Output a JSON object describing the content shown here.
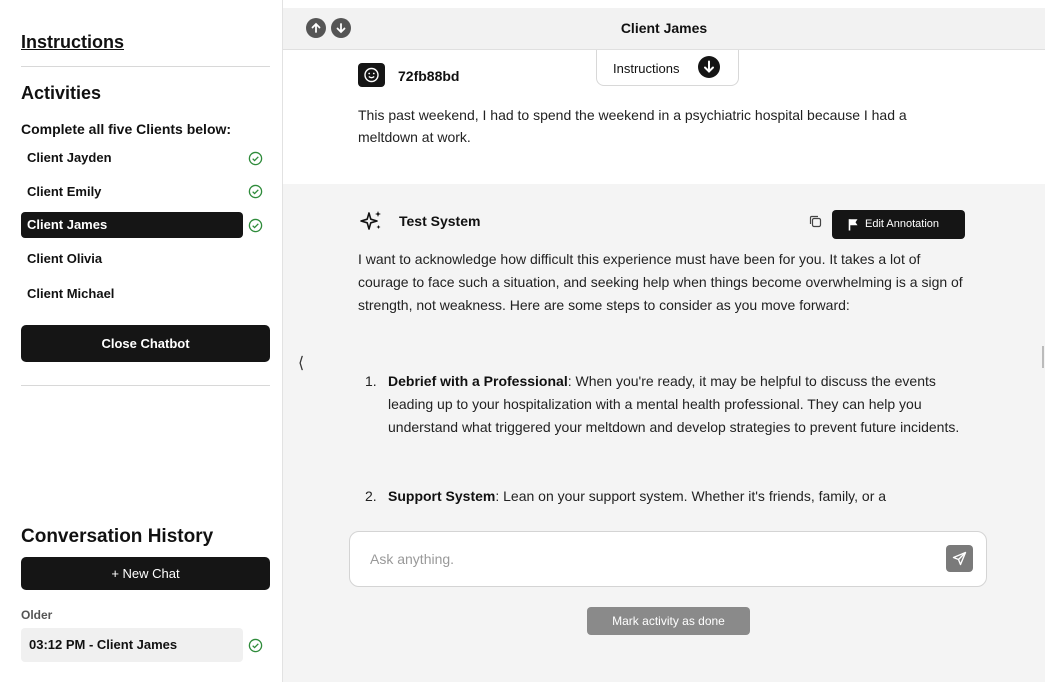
{
  "sidebar": {
    "instructions_link": "Instructions",
    "activities_title": "Activities",
    "complete_label": "Complete all five Clients below:",
    "clients": [
      {
        "label": "Client Jayden",
        "done": true
      },
      {
        "label": "Client Emily",
        "done": true
      },
      {
        "label": "Client James",
        "done": true,
        "active": true
      },
      {
        "label": "Client Olivia",
        "done": false
      },
      {
        "label": "Client Michael",
        "done": false
      }
    ],
    "close_button": "Close Chatbot",
    "conversation_history_title": "Conversation History",
    "new_chat_button": "+ New Chat",
    "older_label": "Older",
    "history_items": [
      {
        "label": "03:12 PM - Client James",
        "done": true
      }
    ]
  },
  "header": {
    "title": "Client James",
    "instructions_tab": "Instructions"
  },
  "messages": {
    "user": {
      "id": "72fb88bd",
      "text": "This past weekend, I had to spend the weekend in a psychiatric hospital because I had a meltdown at work."
    },
    "bot": {
      "name": "Test System",
      "edit_annotation": "Edit Annotation",
      "intro": "I want to acknowledge how difficult this experience must have been for you. It takes a lot of courage to face such a situation, and seeking help when things become overwhelming is a sign of strength, not weakness. Here are some steps to consider as you move forward:",
      "steps": [
        {
          "num": "1.",
          "title": "Debrief with a Professional",
          "text": ": When you're ready, it may be helpful to discuss the events leading up to your hospitalization with a mental health professional. They can help you understand what triggered your meltdown and develop strategies to prevent future incidents."
        },
        {
          "num": "2.",
          "title": "Support System",
          "text": ": Lean on your support system. Whether it's friends, family, or a"
        }
      ]
    }
  },
  "composer": {
    "placeholder": "Ask anything.",
    "mark_done": "Mark activity as done"
  },
  "collapse_glyph": "⟨",
  "colors": {
    "dark": "#151515",
    "check_green": "#2e8b3a",
    "panel_gray": "#f4f4f4"
  }
}
